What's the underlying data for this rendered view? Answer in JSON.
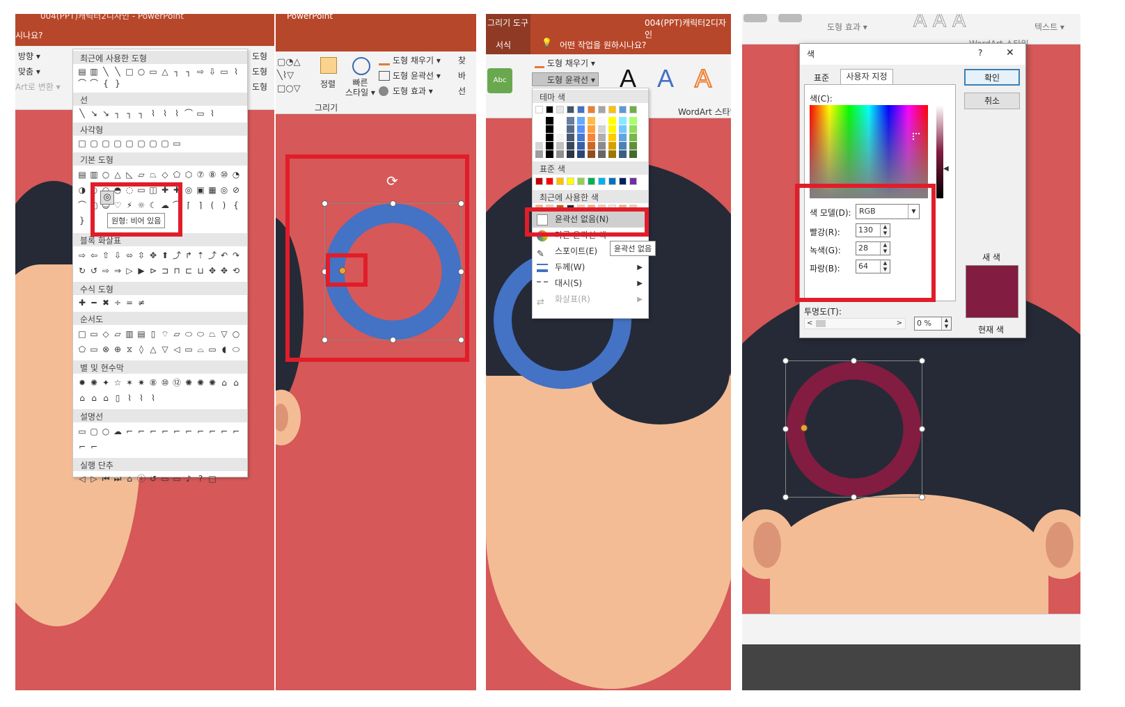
{
  "panel1": {
    "title_partial": "004(PPT)캐릭터2디자인 - PowerPoint",
    "search_partial": "시나요?",
    "ribbon_left": [
      "방향 ▾",
      "맞춤 ▾",
      "Art로 변환 ▾"
    ],
    "ribbon_right": [
      "도형",
      "도형",
      "도형"
    ],
    "sections": [
      "최근에 사용한 도형",
      "선",
      "사각형",
      "기본 도형",
      "블록 화살표",
      "수식 도형",
      "순서도",
      "별 및 현수막",
      "설명선",
      "실행 단추"
    ],
    "tooltip": "원형: 비어 있음"
  },
  "panel2": {
    "title": "PowerPoint",
    "arrange_label": "정렬",
    "quick_style_label": "빠른\n스타일 ▾",
    "fill": "도형 채우기 ▾",
    "outline": "도형 윤곽선 ▾",
    "effect": "도형 효과 ▾",
    "group": "그리기",
    "right_partial": [
      "찾",
      "바",
      "선"
    ]
  },
  "panel3": {
    "context_tab": "그리기 도구",
    "doc_title": "004(PPT)캐릭터2디자인",
    "tab": "서식",
    "tellme": "어떤 작업을 원하시나요?",
    "abc": "Abc",
    "fill": "도형 채우기 ▾",
    "outline": "도형 윤곽선 ▾",
    "wordart_group": "WordArt 스타일",
    "theme_colors": "테마 색",
    "standard_colors": "표준 색",
    "recent_colors": "최근에 사용한 색",
    "menu_items": [
      "윤곽선 없음(N)",
      "다른 윤곽선 색",
      "스포이트(E)",
      "두께(W)",
      "대시(S)",
      "화살표(R)"
    ],
    "tooltip": "윤곽선 없음",
    "theme_top": [
      "#ffffff",
      "#000000",
      "#e7e6e6",
      "#44546a",
      "#4472c4",
      "#ed7d31",
      "#a5a5a5",
      "#ffc000",
      "#5b9bd5",
      "#70ad47"
    ],
    "standard": [
      "#c00000",
      "#ff0000",
      "#ffc000",
      "#ffff00",
      "#92d050",
      "#00b050",
      "#00b0f0",
      "#0070c0",
      "#002060",
      "#7030a0"
    ],
    "recent": [
      "#f4b183",
      "#f8cbad",
      "#c55a11",
      "#222222",
      "#f8cbad",
      "#f4b183",
      "#f8cbad",
      "#fbe5d6",
      "#f4b183",
      "#f8cbad"
    ]
  },
  "panel4": {
    "ribbon_partial": [
      "도형 효과 ▾",
      "텍스트 ▾",
      "WordArt 스타일"
    ],
    "dialog": {
      "title": "색",
      "help": "?",
      "close": "✕",
      "tabs": [
        "표준",
        "사용자 지정"
      ],
      "color_label": "색(C):",
      "model_label": "색 모델(D):",
      "model_value": "RGB",
      "red_label": "빨강(R):",
      "red": "130",
      "green_label": "녹색(G):",
      "green": "28",
      "blue_label": "파랑(B):",
      "blue": "64",
      "transparency_label": "투명도(T):",
      "transparency": "0 %",
      "ok": "확인",
      "cancel": "취소",
      "new_label": "새 색",
      "current_label": "현재 색",
      "new_color": "#821c40"
    }
  },
  "colors": {
    "bg_red": "#d65858",
    "hair": "#252a36",
    "skin": "#f3bc95",
    "ring_blue": "#4472c4",
    "ring_maroon": "#821c40",
    "highlight": "#e11d2a"
  }
}
